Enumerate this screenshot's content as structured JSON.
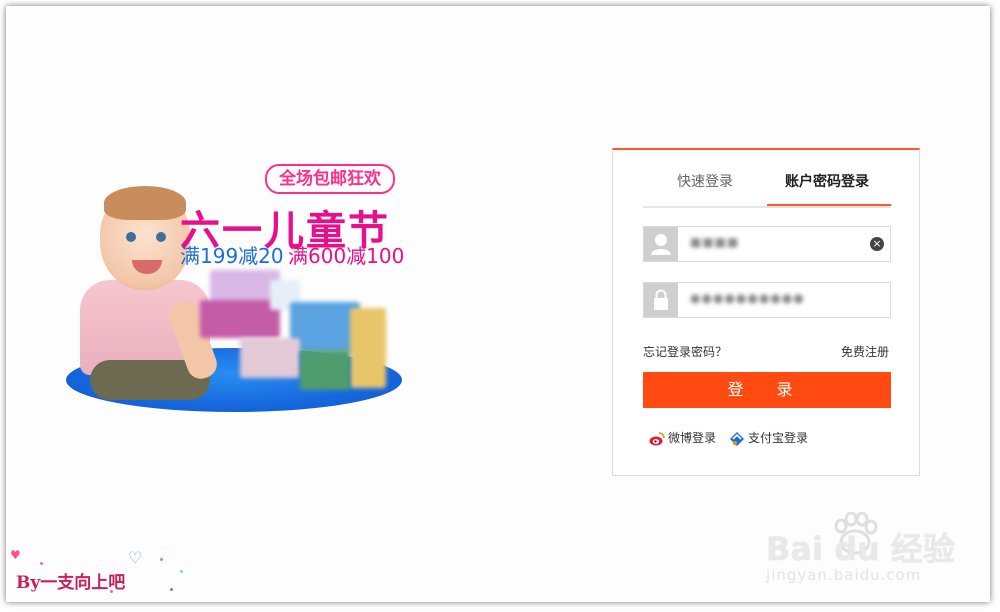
{
  "promo": {
    "badge": "全场包邮狂欢",
    "title": "六一儿童节",
    "deal_1": "满199减20",
    "deal_2": "满600减100"
  },
  "login": {
    "tab_quick": "快速登录",
    "tab_account": "账户密码登录",
    "active_tab": "账户密码登录",
    "username_value": "■■■■",
    "password_value": "●●●●●●●●●●",
    "forgot_password": "忘记登录密码？",
    "register": "免费注册",
    "login_button": "登 录",
    "weibo_login": "微博登录",
    "alipay_login": "支付宝登录"
  },
  "watermark": {
    "signature": "By一支向上吧",
    "baidu_logo": "Bai du 经验",
    "baidu_url": "jingyan.baidu.com"
  },
  "colors": {
    "accent": "#ff4a11",
    "promo_pink": "#e8108a",
    "promo_blue": "#1a6fd6"
  },
  "icons": {
    "user": "user-icon",
    "lock": "lock-icon",
    "clear": "clear-icon",
    "weibo": "weibo-icon",
    "alipay": "alipay-icon"
  }
}
